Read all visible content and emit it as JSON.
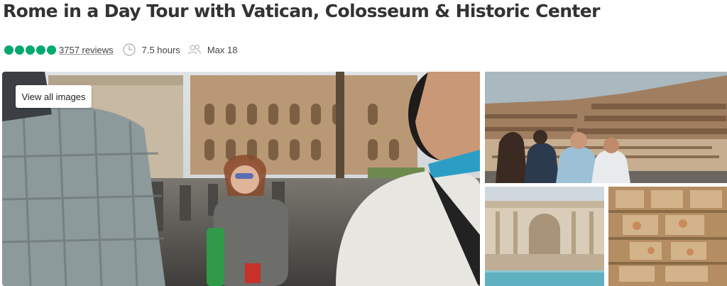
{
  "tour": {
    "title": "Rome in a Day Tour with Vatican, Colosseum & Historic Center"
  },
  "rating": {
    "bubbles": 5,
    "color": "#00aa6c",
    "reviews_label": "3757 reviews"
  },
  "details": {
    "duration_icon": "clock-icon",
    "duration": "7.5 hours",
    "group_icon": "group-icon",
    "group_size": "Max 18"
  },
  "gallery": {
    "view_all_label": "View all images",
    "images": [
      "tour-guide-at-roman-forum",
      "colosseum-interior-selfie",
      "trevi-fountain",
      "sistine-chapel-ceiling"
    ]
  }
}
